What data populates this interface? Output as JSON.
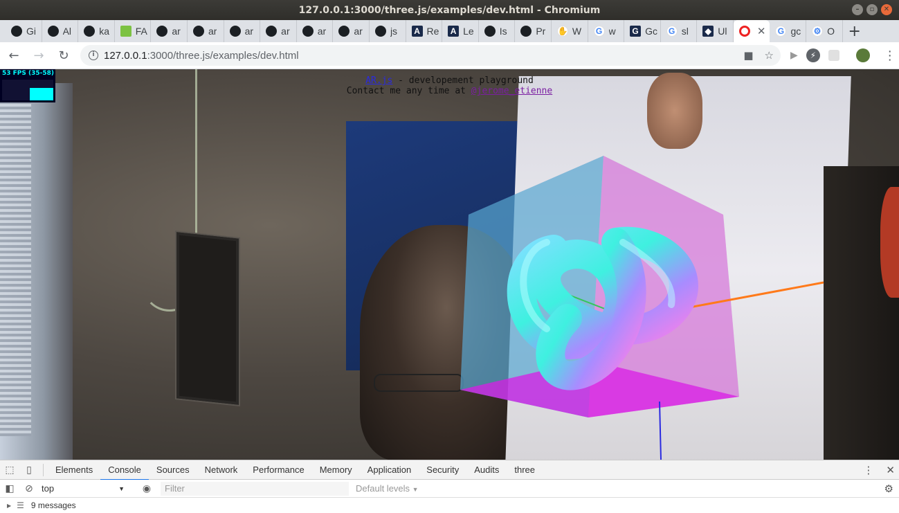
{
  "window": {
    "title": "127.0.0.1:3000/three.js/examples/dev.html - Chromium"
  },
  "tabs": [
    {
      "icon": "github-icon",
      "label": "Gi"
    },
    {
      "icon": "github-icon",
      "label": "Al"
    },
    {
      "icon": "github-icon",
      "label": "ka"
    },
    {
      "icon": "android-icon",
      "label": "FA"
    },
    {
      "icon": "github-icon",
      "label": "ar"
    },
    {
      "icon": "github-icon",
      "label": "ar"
    },
    {
      "icon": "github-icon",
      "label": "ar"
    },
    {
      "icon": "github-icon",
      "label": "ar"
    },
    {
      "icon": "github-icon",
      "label": "ar"
    },
    {
      "icon": "github-icon",
      "label": "ar"
    },
    {
      "icon": "github-icon",
      "label": "js"
    },
    {
      "icon": "aframe-icon",
      "label": "Re"
    },
    {
      "icon": "aframe-icon",
      "label": "Le"
    },
    {
      "icon": "github-icon",
      "label": "Is"
    },
    {
      "icon": "github-icon",
      "label": "Pr"
    },
    {
      "icon": "hand-icon",
      "label": "W"
    },
    {
      "icon": "google-icon",
      "label": "w"
    },
    {
      "icon": "translate-icon",
      "label": "Gc"
    },
    {
      "icon": "google-icon",
      "label": "sl"
    },
    {
      "icon": "bookmark-icon",
      "label": "Ul"
    },
    {
      "icon": "record-icon",
      "label": "",
      "active": true
    },
    {
      "icon": "google-icon",
      "label": "gc"
    },
    {
      "icon": "gear-icon",
      "label": "O"
    }
  ],
  "address": {
    "host": "127.0.0.1",
    "path": ":3000/three.js/examples/dev.html"
  },
  "page": {
    "link_arjs": "AR.js",
    "line1_rest": " - developement playground",
    "line2_prefix": "Contact me any time at ",
    "link_twitter": "@jerome_etienne",
    "fps_label": "53 FPS (35-58)"
  },
  "devtools": {
    "tabs": [
      "Elements",
      "Console",
      "Sources",
      "Network",
      "Performance",
      "Memory",
      "Application",
      "Security",
      "Audits",
      "three"
    ],
    "active_tab": "Console",
    "context": "top",
    "filter_placeholder": "Filter",
    "levels": "Default levels",
    "messages": "9 messages"
  },
  "colors": {
    "devtools_accent": "#1a73e8",
    "fps_text": "#00ffff",
    "cube_magenta": "#d91ce6",
    "cube_cyan": "#3fb9d6",
    "axis_red": "#ff7a1a",
    "axis_green": "#34c759",
    "axis_blue": "#2a2ae0"
  }
}
